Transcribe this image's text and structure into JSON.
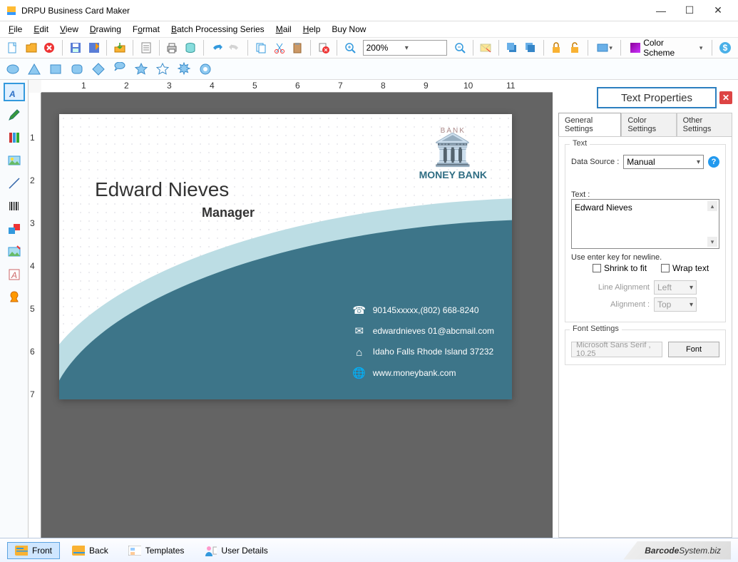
{
  "window": {
    "title": "DRPU Business Card Maker"
  },
  "menu": [
    "File",
    "Edit",
    "View",
    "Drawing",
    "Format",
    "Batch Processing Series",
    "Mail",
    "Help",
    "Buy Now"
  ],
  "toolbar": {
    "zoom": "200%",
    "color_scheme": "Color Scheme"
  },
  "shapes": [
    "ellipse",
    "triangle",
    "rectangle",
    "rounded-rect",
    "diamond",
    "cloud",
    "star",
    "star-outline",
    "burst",
    "gear"
  ],
  "left_tools": [
    "text",
    "pencil",
    "library",
    "image",
    "line",
    "barcode",
    "shapes",
    "clipart",
    "watermark",
    "custom"
  ],
  "zoom_levels": [
    "200%"
  ],
  "card": {
    "name": "Edward Nieves",
    "role": "Manager",
    "bank_arc": "BANK",
    "bank_label": "MONEY BANK",
    "phone": "90145xxxxx,(802) 668-8240",
    "email": "edwardnieves 01@abcmail.com",
    "address": "Idaho Falls Rhode Island 37232",
    "website": "www.moneybank.com"
  },
  "panel": {
    "title": "Text Properties",
    "tabs": [
      "General Settings",
      "Color Settings",
      "Other Settings"
    ],
    "active_tab": "General Settings",
    "text_group": "Text",
    "data_source_label": "Data Source :",
    "data_source_value": "Manual",
    "text_label": "Text :",
    "text_value": "Edward Nieves",
    "hint": "Use enter key for newline.",
    "shrink": "Shrink to fit",
    "wrap": "Wrap text",
    "line_align_label": "Line Alignment",
    "line_align_value": "Left",
    "align_label": "Alignment :",
    "align_value": "Top",
    "font_group": "Font Settings",
    "font_value": "Microsoft Sans Serif , 10.25",
    "font_btn": "Font"
  },
  "bottom": {
    "front": "Front",
    "back": "Back",
    "templates": "Templates",
    "user_details": "User Details",
    "brand_a": "Barcode",
    "brand_b": "System",
    "brand_c": ".biz"
  },
  "ruler_h": [
    "1",
    "2",
    "3",
    "4",
    "5",
    "6",
    "7",
    "8",
    "9",
    "10",
    "11"
  ],
  "ruler_v": [
    "1",
    "2",
    "3",
    "4",
    "5",
    "6",
    "7"
  ]
}
